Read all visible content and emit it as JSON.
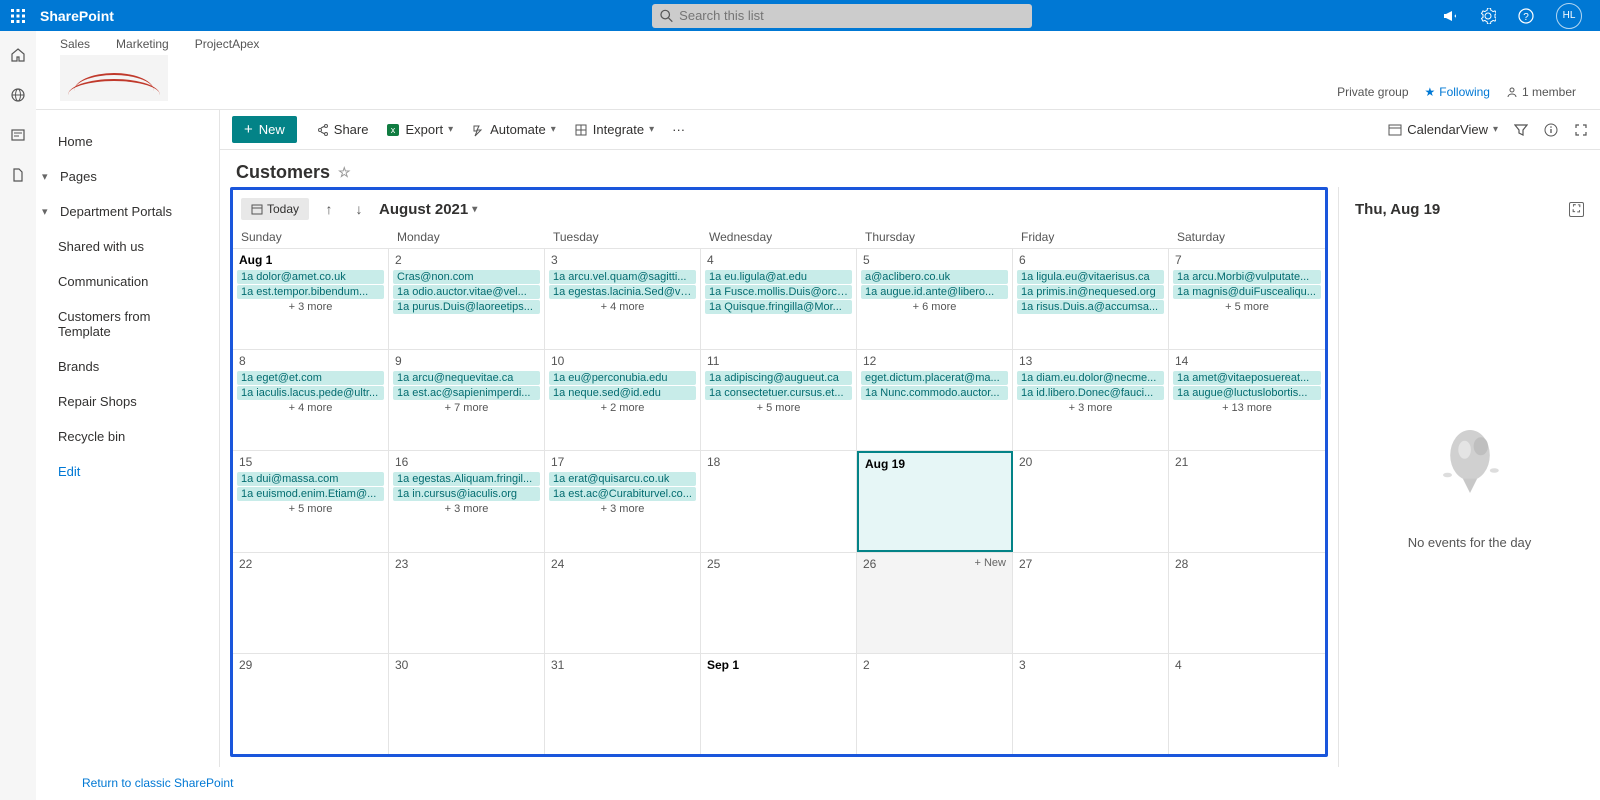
{
  "suite": {
    "brand": "SharePoint",
    "search_placeholder": "Search this list",
    "avatar": "HL"
  },
  "hub": {
    "tabs": [
      "Sales",
      "Marketing",
      "ProjectApex"
    ],
    "privacy": "Private group",
    "following": "Following",
    "members": "1 member"
  },
  "nav": {
    "items": [
      {
        "label": "Home"
      },
      {
        "label": "Pages",
        "chev": true
      },
      {
        "label": "Department Portals",
        "chev": true
      },
      {
        "label": "Shared with us"
      },
      {
        "label": "Communication"
      },
      {
        "label": "Customers from Template"
      },
      {
        "label": "Brands"
      },
      {
        "label": "Repair Shops"
      },
      {
        "label": "Recycle bin"
      },
      {
        "label": "Edit",
        "edit": true
      }
    ],
    "footer": "Return to classic SharePoint"
  },
  "cmd": {
    "new": "New",
    "share": "Share",
    "export": "Export",
    "automate": "Automate",
    "integrate": "Integrate",
    "view": "CalendarView"
  },
  "title": "Customers",
  "calendar": {
    "today": "Today",
    "month": "August 2021",
    "daynames": [
      "Sunday",
      "Monday",
      "Tuesday",
      "Wednesday",
      "Thursday",
      "Friday",
      "Saturday"
    ],
    "weeks": [
      [
        {
          "n": "Aug 1",
          "strong": true,
          "ev": [
            "1a dolor@amet.co.uk",
            "1a est.tempor.bibendum..."
          ],
          "more": "+ 3 more"
        },
        {
          "n": "2",
          "ev": [
            "Cras@non.com",
            "1a odio.auctor.vitae@vel...",
            "1a purus.Duis@laoreetips..."
          ]
        },
        {
          "n": "3",
          "ev": [
            "1a arcu.vel.quam@sagitti...",
            "1a egestas.lacinia.Sed@ve..."
          ],
          "more": "+ 4 more"
        },
        {
          "n": "4",
          "ev": [
            "1a eu.ligula@at.edu",
            "1a Fusce.mollis.Duis@orci...",
            "1a Quisque.fringilla@Mor..."
          ]
        },
        {
          "n": "5",
          "ev": [
            "a@aclibero.co.uk",
            "1a augue.id.ante@libero..."
          ],
          "more": "+ 6 more"
        },
        {
          "n": "6",
          "ev": [
            "1a ligula.eu@vitaerisus.ca",
            "1a primis.in@nequesed.org",
            "1a risus.Duis.a@accumsa..."
          ]
        },
        {
          "n": "7",
          "ev": [
            "1a arcu.Morbi@vulputate...",
            "1a magnis@duiFuscealiqu..."
          ],
          "more": "+ 5 more"
        }
      ],
      [
        {
          "n": "8",
          "ev": [
            "1a eget@et.com",
            "1a iaculis.lacus.pede@ultr..."
          ],
          "more": "+ 4 more"
        },
        {
          "n": "9",
          "ev": [
            "1a arcu@nequevitae.ca",
            "1a est.ac@sapienimperdi..."
          ],
          "more": "+ 7 more"
        },
        {
          "n": "10",
          "ev": [
            "1a eu@perconubia.edu",
            "1a neque.sed@id.edu"
          ],
          "more": "+ 2 more"
        },
        {
          "n": "11",
          "ev": [
            "1a adipiscing@augueut.ca",
            "1a consectetuer.cursus.et..."
          ],
          "more": "+ 5 more"
        },
        {
          "n": "12",
          "ev": [
            "eget.dictum.placerat@ma...",
            "1a Nunc.commodo.auctor..."
          ]
        },
        {
          "n": "13",
          "ev": [
            "1a diam.eu.dolor@necme...",
            "1a id.libero.Donec@fauci..."
          ],
          "more": "+ 3 more"
        },
        {
          "n": "14",
          "ev": [
            "1a amet@vitaeposuereat...",
            "1a augue@luctuslobortis..."
          ],
          "more": "+ 13 more"
        }
      ],
      [
        {
          "n": "15",
          "ev": [
            "1a dui@massa.com",
            "1a euismod.enim.Etiam@..."
          ],
          "more": "+ 5 more"
        },
        {
          "n": "16",
          "ev": [
            "1a egestas.Aliquam.fringil...",
            "1a in.cursus@iaculis.org"
          ],
          "more": "+ 3 more"
        },
        {
          "n": "17",
          "ev": [
            "1a erat@quisarcu.co.uk",
            "1a est.ac@Curabiturvel.co..."
          ],
          "more": "+ 3 more"
        },
        {
          "n": "18",
          "ev": []
        },
        {
          "n": "Aug 19",
          "selected": true,
          "ev": []
        },
        {
          "n": "20",
          "ev": []
        },
        {
          "n": "21",
          "ev": []
        }
      ],
      [
        {
          "n": "22",
          "ev": []
        },
        {
          "n": "23",
          "ev": []
        },
        {
          "n": "24",
          "ev": []
        },
        {
          "n": "25",
          "ev": []
        },
        {
          "n": "26",
          "hover": true,
          "ev": [],
          "addnew": "+ New"
        },
        {
          "n": "27",
          "ev": []
        },
        {
          "n": "28",
          "ev": []
        }
      ],
      [
        {
          "n": "29",
          "ev": []
        },
        {
          "n": "30",
          "ev": []
        },
        {
          "n": "31",
          "ev": []
        },
        {
          "n": "Sep 1",
          "strong": true,
          "ev": []
        },
        {
          "n": "2",
          "ev": []
        },
        {
          "n": "3",
          "ev": []
        },
        {
          "n": "4",
          "ev": []
        }
      ]
    ]
  },
  "daypane": {
    "title": "Thu, Aug 19",
    "empty": "No events for the day"
  }
}
